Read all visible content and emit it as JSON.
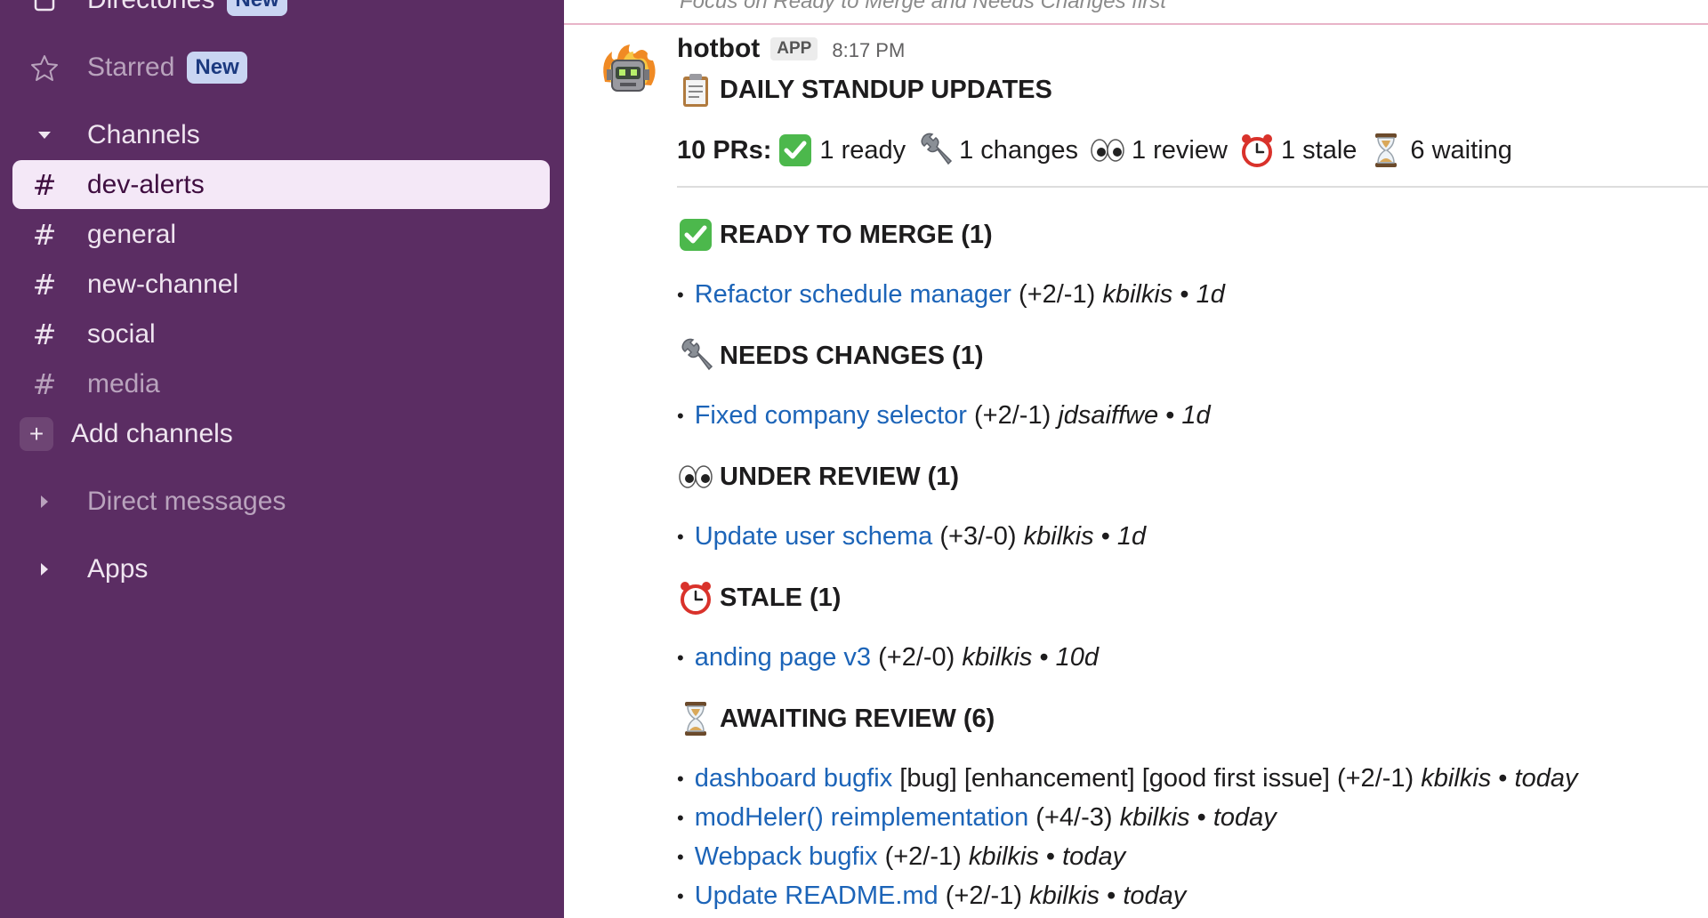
{
  "sidebar": {
    "directories": {
      "label": "Directories",
      "badge": "New"
    },
    "starred": {
      "label": "Starred",
      "badge": "New"
    },
    "channels_header": "Channels",
    "channels": [
      {
        "name": "dev-alerts",
        "active": true
      },
      {
        "name": "general",
        "active": false
      },
      {
        "name": "new-channel",
        "active": false
      },
      {
        "name": "social",
        "active": false
      },
      {
        "name": "media",
        "active": false
      }
    ],
    "hash_symbol": "#",
    "add_channels": "Add channels",
    "add_symbol": "+",
    "direct_messages": "Direct messages",
    "apps": "Apps"
  },
  "main": {
    "top_hint": "Focus on Ready to Merge and Needs Changes first",
    "message": {
      "bot_name": "hotbot",
      "app_tag": "APP",
      "time": "8:17 PM",
      "title": "DAILY STANDUP UPDATES",
      "summary": {
        "prefix": "10 PRs:",
        "ready": "1 ready",
        "changes": "1 changes",
        "review": "1 review",
        "stale": "1 stale",
        "waiting": "6 waiting"
      },
      "sections": [
        {
          "title": "READY TO MERGE (1)",
          "icon": "check-icon",
          "items": [
            {
              "link": "Refactor schedule manager",
              "tags": "",
              "diff": "(+2/-1)",
              "author": "kbilkis",
              "age": "1d"
            }
          ]
        },
        {
          "title": "NEEDS CHANGES (1)",
          "icon": "wrench-icon",
          "items": [
            {
              "link": "Fixed company selector",
              "tags": "",
              "diff": "(+2/-1)",
              "author": "jdsaiffwe",
              "age": "1d"
            }
          ]
        },
        {
          "title": "UNDER REVIEW (1)",
          "icon": "eyes-icon",
          "items": [
            {
              "link": "Update user schema",
              "tags": "",
              "diff": "(+3/-0)",
              "author": "kbilkis",
              "age": "1d"
            }
          ]
        },
        {
          "title": "STALE (1)",
          "icon": "alarm-clock-icon",
          "items": [
            {
              "link": "anding page v3",
              "tags": "",
              "diff": "(+2/-0)",
              "author": "kbilkis",
              "age": "10d"
            }
          ]
        },
        {
          "title": "AWAITING REVIEW (6)",
          "icon": "hourglass-icon",
          "items": [
            {
              "link": "dashboard bugfix",
              "tags": "[bug] [enhancement] [good first issue]",
              "diff": "(+2/-1)",
              "author": "kbilkis",
              "age": "today"
            },
            {
              "link": "modHeler() reimplementation",
              "tags": "",
              "diff": "(+4/-3)",
              "author": "kbilkis",
              "age": "today"
            },
            {
              "link": "Webpack bugfix",
              "tags": "",
              "diff": "(+2/-1)",
              "author": "kbilkis",
              "age": "today"
            },
            {
              "link": "Update README.md",
              "tags": "",
              "diff": "(+2/-1)",
              "author": "kbilkis",
              "age": "today"
            }
          ]
        }
      ],
      "bullet": "•",
      "separator": "•"
    }
  },
  "colors": {
    "sidebar_bg": "#5b2d63",
    "active_bg": "#f4e8f7",
    "link": "#1c64b8",
    "badge_bg": "#c9d5f2"
  }
}
